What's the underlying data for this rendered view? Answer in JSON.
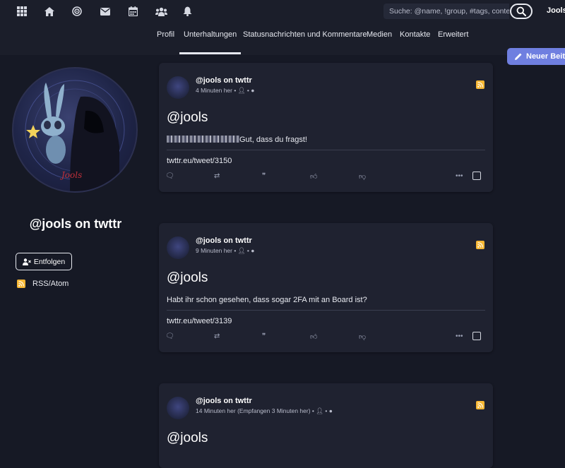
{
  "topbar": {
    "icons": [
      "apps-icon",
      "home-icon",
      "target-icon",
      "mail-icon",
      "calendar-icon",
      "group-icon",
      "bell-icon"
    ],
    "search_placeholder": "Suche: @name, !group, #tags, content",
    "username": "Jools"
  },
  "subnav": {
    "tabs": [
      {
        "label": "Profil"
      },
      {
        "label": "Unterhaltungen"
      },
      {
        "label": "Statusnachrichten und Kommentare"
      },
      {
        "label": "Medien"
      },
      {
        "label": "Kontakte"
      },
      {
        "label": "Erweitert"
      }
    ],
    "new_button": "Neuer Beit"
  },
  "profile": {
    "name": "@jools on twttr",
    "unfollow_label": "Entfolgen",
    "rss_label": "RSS/Atom"
  },
  "posts": [
    {
      "author": "@jools on twttr",
      "time": "4 Minuten her",
      "title": "@jools",
      "body": "Gut, dass du fragst!",
      "link": "twttr.eu/tweet/3150"
    },
    {
      "author": "@jools on twttr",
      "time": "9 Minuten her",
      "title": "@jools",
      "body": "Habt ihr schon gesehen, dass sogar 2FA mit an Board ist?",
      "link": "twttr.eu/tweet/3139"
    },
    {
      "author": "@jools on twttr",
      "time": "14 Minuten her (Empfangen 3 Minuten her)",
      "title": "@jools",
      "body": "",
      "link": ""
    }
  ],
  "colors": {
    "accent": "#6f7fe0",
    "rss": "#f7b733",
    "background": "#161925",
    "card": "#1f2230"
  }
}
